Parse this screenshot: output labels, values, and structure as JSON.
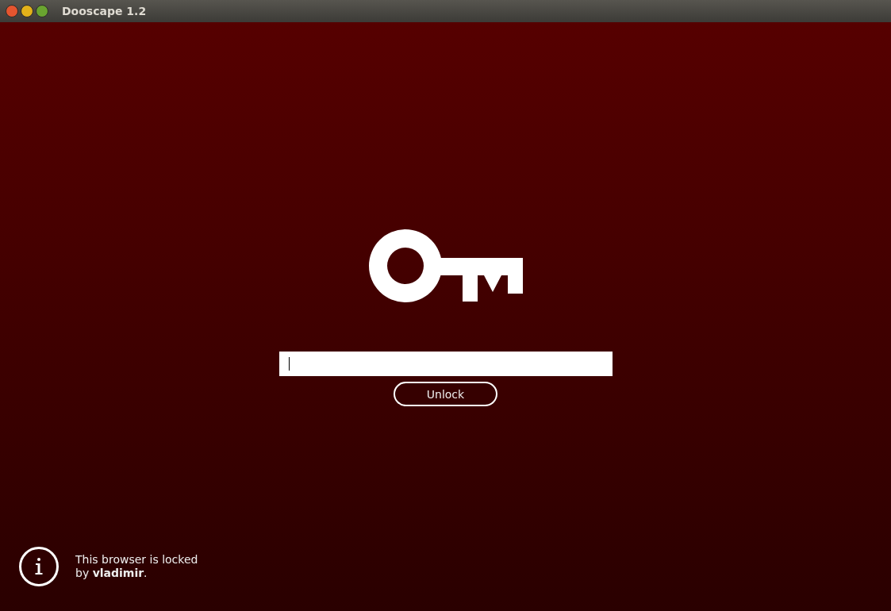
{
  "window": {
    "title": "Dooscape 1.2"
  },
  "lock_screen": {
    "password_field": {
      "focused": true
    },
    "unlock_button": "Unlock"
  },
  "notice": {
    "text": "This browser is locked\nby **vladimir**."
  }
}
